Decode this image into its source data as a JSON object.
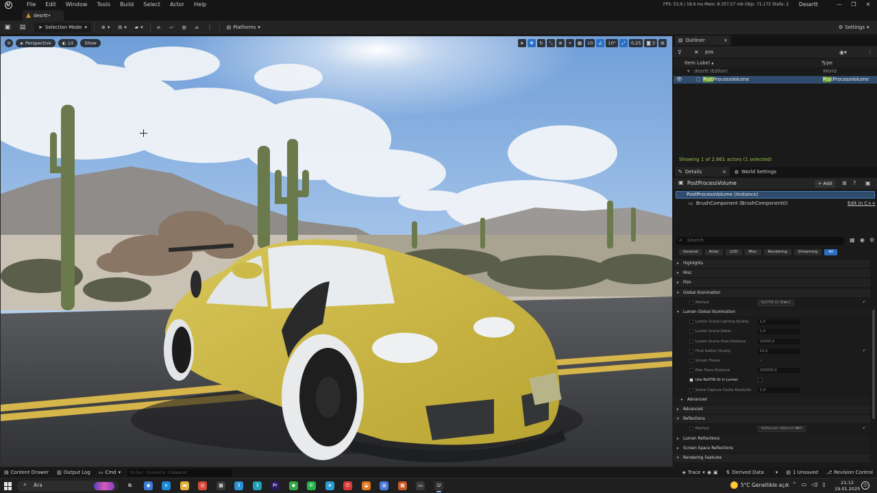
{
  "menubar": {
    "items": [
      "File",
      "Edit",
      "Window",
      "Tools",
      "Build",
      "Select",
      "Actor",
      "Help"
    ],
    "stats": "FPS: 53,9 / 18,9 ms  Mem: 8.357,57 mb  Objs: 71.175  Stalls: 2",
    "project": "Desertt",
    "logo": "U"
  },
  "tab": {
    "label": "desrtt•"
  },
  "toolbar": {
    "selection_mode": "Selection Mode",
    "platforms": "Platforms",
    "settings": "Settings"
  },
  "viewport": {
    "perspective": "Perspective",
    "lit": "Lit",
    "show": "Show",
    "grid_value": "10",
    "angle_value": "10°",
    "scale_value": "0.25",
    "camera_speed": "3"
  },
  "outliner": {
    "tab": "Outliner",
    "search_value": "pos",
    "col_label": "Item Label ▴",
    "col_type": "Type",
    "rows": [
      {
        "name": "desrtt (Editor)",
        "type": "World"
      },
      {
        "name_hl": "Post",
        "name_rest": "ProcessVolume",
        "type_hl": "Pos",
        "type_rest": "tProcessVolume"
      }
    ],
    "status": "Showing 1 of 2.661 actors (1 selected)"
  },
  "details": {
    "tab": "Details",
    "world_tab": "World Settings",
    "actor_name": "PostProcessVolume",
    "add": "+ Add",
    "instance": "PostProcessVolume (Instance)",
    "component": "BrushComponent (BrushComponent0)",
    "edit_cpp": "Edit in C++",
    "search_placeholder": "Search",
    "filters": [
      "General",
      "Actor",
      "LOD",
      "Misc",
      "Rendering",
      "Streaming",
      "All"
    ],
    "rows": [
      {
        "kind": "cat",
        "label": "Highlights",
        "arrow": "▸"
      },
      {
        "kind": "cat",
        "label": "Misc",
        "arrow": "▸"
      },
      {
        "kind": "cat",
        "label": "Film",
        "arrow": "▸"
      },
      {
        "kind": "cat",
        "label": "Global Illumination",
        "arrow": "▾"
      },
      {
        "kind": "prop",
        "label": "Method",
        "value": "ReSTIR GI (Beta)",
        "dropdown": true,
        "indent": 0,
        "reset": true
      },
      {
        "kind": "cat",
        "label": "Lumen Global Illumination",
        "arrow": "▾",
        "dark": true
      },
      {
        "kind": "prop",
        "label": "Lumen Scene Lighting Quality",
        "value": "1,0",
        "field": true
      },
      {
        "kind": "prop",
        "label": "Lumen Scene Detail",
        "value": "1,0",
        "field": true
      },
      {
        "kind": "prop",
        "label": "Lumen Scene View Distance",
        "value": "20000,0",
        "field": true
      },
      {
        "kind": "prop",
        "label": "Final Gather Quality",
        "value": "10,0",
        "field": true,
        "reset": true
      },
      {
        "kind": "prop",
        "label": "Screen Traces",
        "value": "✓",
        "check": true
      },
      {
        "kind": "prop",
        "label": "Max Trace Distance",
        "value": "200000,0",
        "field": true
      },
      {
        "kind": "prop",
        "label": "Use ReSTIR GI in Lumen",
        "value": "",
        "checked": true,
        "bright": true
      },
      {
        "kind": "prop",
        "label": "Scene Capture Cache Resolutio",
        "value": "1,0",
        "field": true
      },
      {
        "kind": "cat",
        "label": "Advanced",
        "arrow": "▸",
        "dark": true,
        "indent": true
      },
      {
        "kind": "cat",
        "label": "Advanced",
        "arrow": "▸"
      },
      {
        "kind": "cat",
        "label": "Reflections",
        "arrow": "▾"
      },
      {
        "kind": "prop",
        "label": "Method",
        "value": "Reflection Method MAX",
        "dropdown": true,
        "reset": true
      },
      {
        "kind": "cat",
        "label": "Lumen Reflections",
        "arrow": "▸",
        "dark": true
      },
      {
        "kind": "cat",
        "label": "Screen Space Reflections",
        "arrow": "▸",
        "dark": true
      },
      {
        "kind": "cat",
        "label": "Rendering Features",
        "arrow": "▾"
      }
    ]
  },
  "statusbar": {
    "content_drawer": "Content Drawer",
    "output_log": "Output Log",
    "cmd": "Cmd",
    "console_placeholder": "Enter Console Command",
    "trace": "Trace",
    "derived_data": "Derived Data",
    "unsaved": "1 Unsaved",
    "revision_control": "Revision Control"
  },
  "taskbar": {
    "search_placeholder": "Ara",
    "weather": "5°C  Genellikle açık",
    "time": "21:12",
    "date": "19.01.2025",
    "apps": [
      {
        "name": "task-view-icon",
        "glyph": "⧉",
        "color": "#1f1f1f"
      },
      {
        "name": "copilot-icon",
        "glyph": "◉",
        "color": "#3a7bd5"
      },
      {
        "name": "edge-icon",
        "glyph": "e",
        "color": "#1a8ad4"
      },
      {
        "name": "file-explorer-icon",
        "glyph": "▬",
        "color": "#e2b23c"
      },
      {
        "name": "chrome-icon",
        "glyph": "◎",
        "color": "#d84a3a"
      },
      {
        "name": "store-icon",
        "glyph": "▦",
        "color": "#3a3a3a"
      },
      {
        "name": "app-blue-icon",
        "glyph": "3",
        "color": "#2a8fd4"
      },
      {
        "name": "app-teal-icon",
        "glyph": "3",
        "color": "#1fa0b4"
      },
      {
        "name": "premiere-icon",
        "glyph": "Pr",
        "color": "#2a1a5e"
      },
      {
        "name": "app-green-icon",
        "glyph": "◆",
        "color": "#35a845"
      },
      {
        "name": "whatsapp-icon",
        "glyph": "✆",
        "color": "#25b34a"
      },
      {
        "name": "telegram-icon",
        "glyph": "➤",
        "color": "#2a9ed8"
      },
      {
        "name": "power-icon",
        "glyph": "⏻",
        "color": "#d83a3a"
      },
      {
        "name": "blender-icon",
        "glyph": "◒",
        "color": "#e07a22"
      },
      {
        "name": "browser-icon",
        "glyph": "◍",
        "color": "#4a7ad8"
      },
      {
        "name": "grid-app-icon",
        "glyph": "▦",
        "color": "#c8582a"
      },
      {
        "name": "folder-app-icon",
        "glyph": "▭",
        "color": "#3a3a3a"
      },
      {
        "name": "unreal-icon",
        "glyph": "U",
        "color": "#333"
      }
    ]
  }
}
